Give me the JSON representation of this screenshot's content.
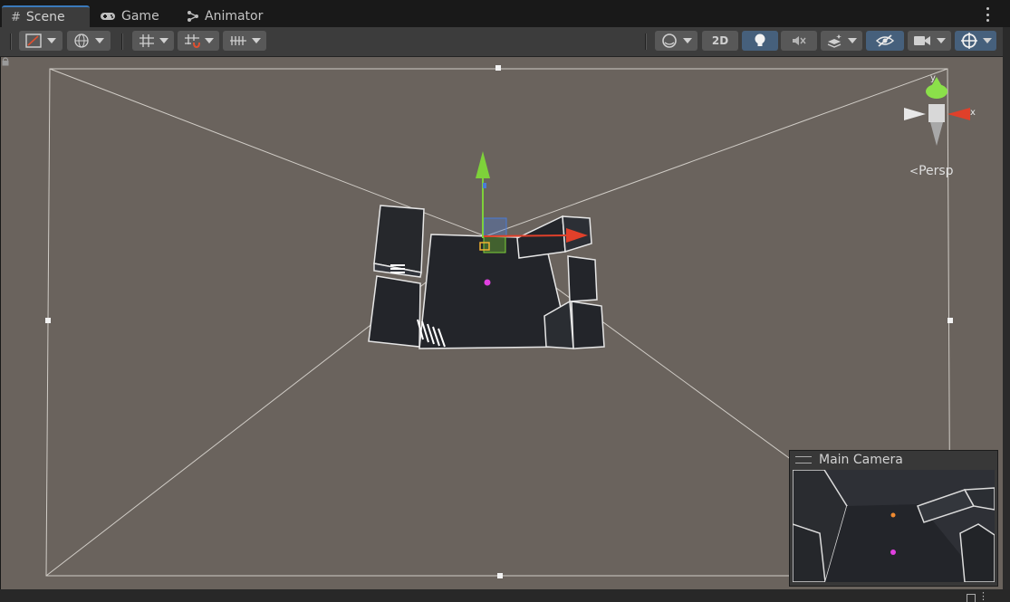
{
  "tabs": [
    {
      "label": "Scene",
      "icon": "grid-icon"
    },
    {
      "label": "Game",
      "icon": "gamepad-icon"
    },
    {
      "label": "Animator",
      "icon": "animator-icon"
    }
  ],
  "toolbar": {
    "mode_2d_label": "2D"
  },
  "scene": {
    "projection_label": "Persp",
    "gizmo_axes": {
      "y": "y",
      "x": "x"
    }
  },
  "camera_preview": {
    "title": "Main Camera"
  },
  "colors": {
    "accent": "#3a79bb",
    "x_axis": "#e0402a",
    "y_axis": "#7ed13a",
    "z_axis": "#4a7bd6"
  }
}
